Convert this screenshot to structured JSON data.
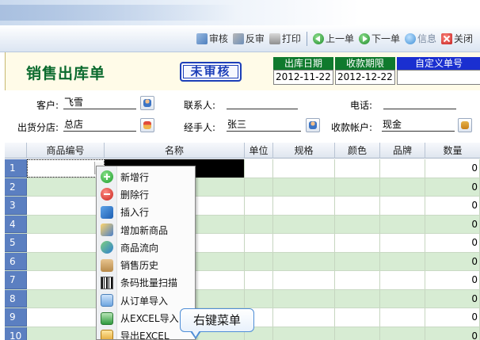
{
  "toolbar": {
    "items": [
      {
        "label": "审核",
        "icon": "audit-icon"
      },
      {
        "label": "反审",
        "icon": "unaudit-icon"
      },
      {
        "label": "打印",
        "icon": "print-icon"
      },
      {
        "label": "上一单",
        "icon": "prev-icon"
      },
      {
        "label": "下一单",
        "icon": "next-icon"
      },
      {
        "label": "信息",
        "icon": "info-icon"
      },
      {
        "label": "关闭",
        "icon": "close-icon"
      }
    ]
  },
  "header": {
    "title": "销售出库单",
    "status_stamp": "未审核",
    "ship_date_label": "出库日期",
    "ship_date": "2012-11-22",
    "due_date_label": "收款期限",
    "due_date": "2012-12-22",
    "custom_no_label": "自定义单号",
    "custom_no": "",
    "colors": {
      "title": "#0b6b2e",
      "stamp": "#1d3fb8",
      "label_green": "#0f7a2d",
      "label_blue": "#1a2fd0"
    }
  },
  "form": {
    "customer_label": "客户:",
    "customer": "飞雪",
    "contact_label": "联系人:",
    "contact": "",
    "phone_label": "电话:",
    "phone": "",
    "branch_label": "出货分店:",
    "branch": "总店",
    "handler_label": "经手人:",
    "handler": "张三",
    "account_label": "收款帐户:",
    "account": "现金"
  },
  "grid": {
    "columns": [
      "",
      "商品编号",
      "名称",
      "单位",
      "规格",
      "颜色",
      "品牌",
      "数量"
    ],
    "rows": [
      {
        "no": "1",
        "qty": "0"
      },
      {
        "no": "2",
        "qty": "0"
      },
      {
        "no": "3",
        "qty": "0"
      },
      {
        "no": "4",
        "qty": "0"
      },
      {
        "no": "5",
        "qty": "0"
      },
      {
        "no": "6",
        "qty": "0"
      },
      {
        "no": "7",
        "qty": "0"
      },
      {
        "no": "8",
        "qty": "0"
      },
      {
        "no": "9",
        "qty": "0"
      },
      {
        "no": "10",
        "qty": "0"
      }
    ]
  },
  "context_menu": {
    "items": [
      {
        "label": "新增行",
        "icon": "add-row-icon"
      },
      {
        "label": "删除行",
        "icon": "delete-row-icon"
      },
      {
        "label": "插入行",
        "icon": "insert-row-icon"
      },
      {
        "label": "增加新商品",
        "icon": "new-product-icon"
      },
      {
        "label": "商品流向",
        "icon": "product-flow-icon"
      },
      {
        "label": "销售历史",
        "icon": "sales-history-icon"
      },
      {
        "label": "条码批量扫描",
        "icon": "barcode-scan-icon"
      },
      {
        "label": "从订单导入",
        "icon": "import-order-icon"
      },
      {
        "label": "从EXCEL导入",
        "icon": "import-excel-icon"
      },
      {
        "label": "导出EXCEL",
        "icon": "export-excel-icon"
      }
    ]
  },
  "callout": {
    "label": "右键菜单"
  }
}
